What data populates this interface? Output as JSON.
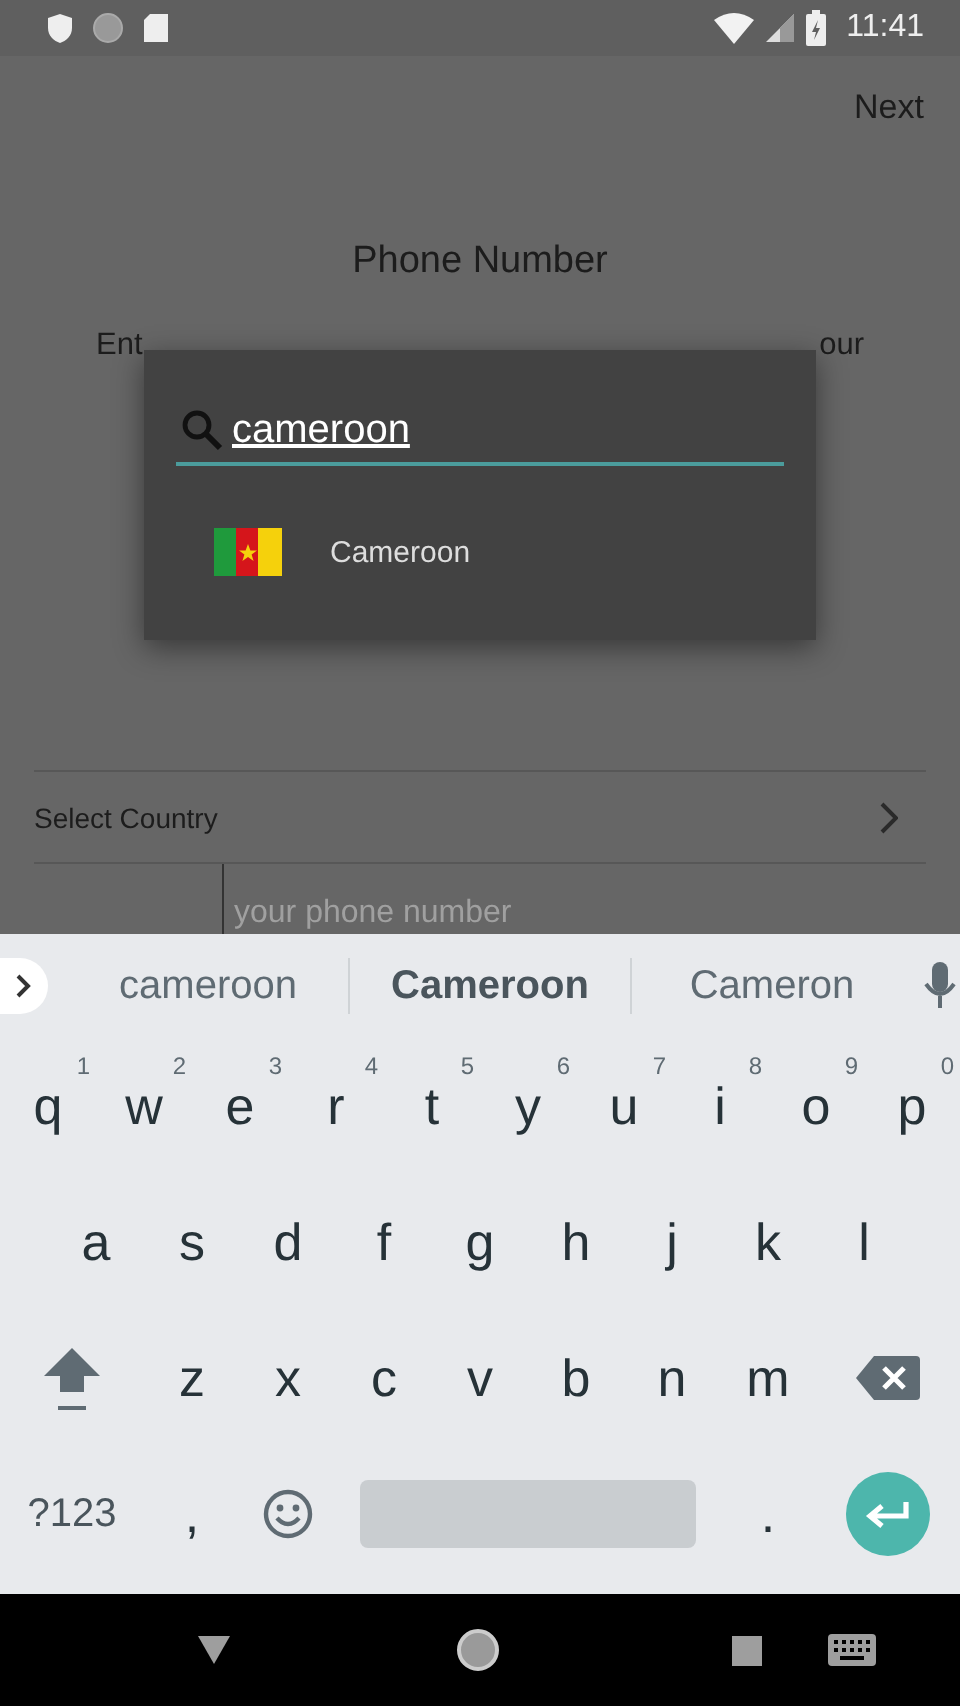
{
  "status_bar": {
    "time": "11:41"
  },
  "toolbar": {
    "action": "Next"
  },
  "title": "Phone Number",
  "instructions": [
    "Ent",
    "our"
  ],
  "select_country": {
    "label": "Select Country"
  },
  "phone_field": {
    "placeholder": "your phone number"
  },
  "country_dialog": {
    "search": {
      "value": "cameroon"
    },
    "results": [
      {
        "name": "Cameroon"
      }
    ]
  },
  "keyboard": {
    "suggestions": [
      {
        "text": "cameroon",
        "selected": false
      },
      {
        "text": "Cameroon",
        "selected": true
      },
      {
        "text": "Cameron",
        "selected": false
      }
    ],
    "rows": [
      {
        "keys": [
          {
            "kind": "letter",
            "label": "q",
            "hint": "1"
          },
          {
            "kind": "letter",
            "label": "w",
            "hint": "2"
          },
          {
            "kind": "letter",
            "label": "e",
            "hint": "3"
          },
          {
            "kind": "letter",
            "label": "r",
            "hint": "4"
          },
          {
            "kind": "letter",
            "label": "t",
            "hint": "5"
          },
          {
            "kind": "letter",
            "label": "y",
            "hint": "6"
          },
          {
            "kind": "letter",
            "label": "u",
            "hint": "7"
          },
          {
            "kind": "letter",
            "label": "i",
            "hint": "8"
          },
          {
            "kind": "letter",
            "label": "o",
            "hint": "9"
          },
          {
            "kind": "letter",
            "label": "p",
            "hint": "0"
          }
        ]
      },
      {
        "keys": [
          {
            "kind": "letter",
            "label": "a"
          },
          {
            "kind": "letter",
            "label": "s"
          },
          {
            "kind": "letter",
            "label": "d"
          },
          {
            "kind": "letter",
            "label": "f"
          },
          {
            "kind": "letter",
            "label": "g"
          },
          {
            "kind": "letter",
            "label": "h"
          },
          {
            "kind": "letter",
            "label": "j"
          },
          {
            "kind": "letter",
            "label": "k"
          },
          {
            "kind": "letter",
            "label": "l"
          }
        ]
      },
      {
        "keys": [
          {
            "kind": "shift"
          },
          {
            "kind": "letter",
            "label": "z"
          },
          {
            "kind": "letter",
            "label": "x"
          },
          {
            "kind": "letter",
            "label": "c"
          },
          {
            "kind": "letter",
            "label": "v"
          },
          {
            "kind": "letter",
            "label": "b"
          },
          {
            "kind": "letter",
            "label": "n"
          },
          {
            "kind": "letter",
            "label": "m"
          },
          {
            "kind": "backspace"
          }
        ]
      },
      {
        "keys": [
          {
            "kind": "symbols",
            "label": "?123"
          },
          {
            "kind": "letter",
            "label": ","
          },
          {
            "kind": "emoji"
          },
          {
            "kind": "space"
          },
          {
            "kind": "letter",
            "label": "."
          },
          {
            "kind": "enter"
          }
        ]
      }
    ]
  }
}
